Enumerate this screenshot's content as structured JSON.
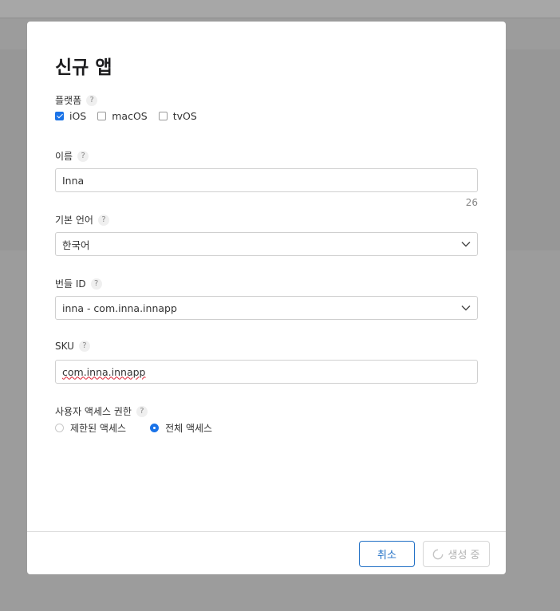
{
  "modal": {
    "title": "신규 앱",
    "platform": {
      "label": "플랫폼",
      "help": "?",
      "options": [
        {
          "label": "iOS",
          "checked": true
        },
        {
          "label": "macOS",
          "checked": false
        },
        {
          "label": "tvOS",
          "checked": false
        }
      ]
    },
    "name": {
      "label": "이름",
      "help": "?",
      "value": "Inna",
      "counter": "26"
    },
    "language": {
      "label": "기본 언어",
      "help": "?",
      "selected": "한국어"
    },
    "bundle": {
      "label": "번들 ID",
      "help": "?",
      "selected": "inna - com.inna.innapp"
    },
    "sku": {
      "label": "SKU",
      "help": "?",
      "value": "com.inna.innapp"
    },
    "access": {
      "label": "사용자 액세스 권한",
      "help": "?",
      "options": [
        {
          "label": "제한된 액세스",
          "selected": false
        },
        {
          "label": "전체 액세스",
          "selected": true
        }
      ]
    },
    "footer": {
      "cancel_label": "취소",
      "create_label": "생성 중"
    }
  },
  "colors": {
    "accent": "#1a73e8",
    "cancel_border": "#1f6fc5",
    "overlay": "#9c9c9c"
  },
  "icons": {
    "dropdown": "chevron-down-icon",
    "loading": "spinner-icon",
    "help": "question-mark-icon"
  }
}
